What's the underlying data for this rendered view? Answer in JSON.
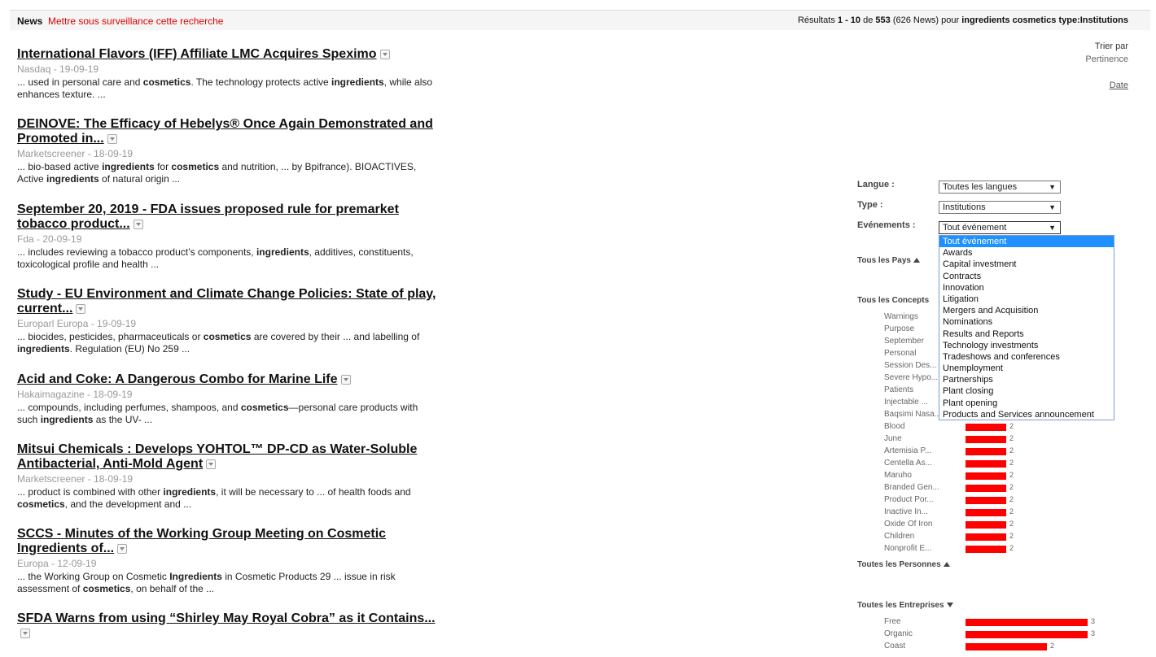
{
  "topbar": {
    "title": "News",
    "watch_link": "Mettre sous surveillance cette recherche",
    "results_prefix": "Résultats",
    "results_range": "1 - 10",
    "results_of": "de",
    "results_total": "553",
    "results_news": "(626 News) pour",
    "results_query": "ingredients cosmetics type:Institutions"
  },
  "articles": [
    {
      "title": "International Flavors (IFF) Affiliate LMC Acquires Speximo",
      "source": "Nasdaq - 19-09-19",
      "snippet": [
        [
          "... used in personal care and ",
          false
        ],
        [
          "cosmetics",
          true
        ],
        [
          ". The technology protects active ",
          false
        ],
        [
          "ingredients",
          true
        ],
        [
          ", while also enhances texture. ...",
          false
        ]
      ]
    },
    {
      "title": "DEINOVE: The Efficacy of Hebelys® Once Again Demonstrated and Promoted in...",
      "source": "Marketscreener - 18-09-19",
      "snippet": [
        [
          "... bio-based active ",
          false
        ],
        [
          "ingredients",
          true
        ],
        [
          " for ",
          false
        ],
        [
          "cosmetics",
          true
        ],
        [
          " and nutrition, ... by Bpifrance). BIOACTIVES, Active ",
          false
        ],
        [
          "ingredients",
          true
        ],
        [
          " of natural origin ...",
          false
        ]
      ]
    },
    {
      "title": "September 20, 2019 - FDA issues proposed rule for premarket tobacco product...",
      "source": "Fda - 20-09-19",
      "snippet": [
        [
          "... includes reviewing a tobacco product’s components, ",
          false
        ],
        [
          "ingredients",
          true
        ],
        [
          ", additives, constituents, toxicological profile and health ...",
          false
        ]
      ]
    },
    {
      "title": "Study - EU Environment and Climate Change Policies: State of play, current...",
      "source": "Europarl Europa - 19-09-19",
      "snippet": [
        [
          "... biocides, pesticides, pharmaceuticals or ",
          false
        ],
        [
          "cosmetics",
          true
        ],
        [
          " are covered by their ... and labelling of ",
          false
        ],
        [
          "ingredients",
          true
        ],
        [
          ". Regulation (EU) No 259 ...",
          false
        ]
      ]
    },
    {
      "title": "Acid and Coke: A Dangerous Combo for Marine Life",
      "source": "Hakaimagazine - 18-09-19",
      "snippet": [
        [
          "... compounds, including perfumes, shampoos, and ",
          false
        ],
        [
          "cosmetics",
          true
        ],
        [
          "—personal care products with such ",
          false
        ],
        [
          "ingredients",
          true
        ],
        [
          " as the UV- ...",
          false
        ]
      ]
    },
    {
      "title": "Mitsui Chemicals : Develops YOHTOL™ DP-CD as Water-Soluble Antibacterial, Anti-Mold Agent",
      "source": "Marketscreener - 18-09-19",
      "snippet": [
        [
          "... product is combined with other ",
          false
        ],
        [
          "ingredients",
          true
        ],
        [
          ", it will be necessary to ... of health foods and ",
          false
        ],
        [
          "cosmetics",
          true
        ],
        [
          ", and the development and ...",
          false
        ]
      ]
    },
    {
      "title": "SCCS - Minutes of the Working Group Meeting on Cosmetic Ingredients of...",
      "source": "Europa - 12-09-19",
      "snippet": [
        [
          "... the Working Group on Cosmetic ",
          false
        ],
        [
          "Ingredients",
          true
        ],
        [
          " in Cosmetic Products 29 ... issue in risk assessment of ",
          false
        ],
        [
          "cosmetics",
          true
        ],
        [
          ", on behalf of the ...",
          false
        ]
      ]
    },
    {
      "title": "SFDA Warns from using “Shirley May Royal Cobra” as it Contains...",
      "source": "",
      "snippet": []
    }
  ],
  "sort": {
    "label": "Trier par",
    "relevance": "Pertinence",
    "date": "Date"
  },
  "filters": {
    "language": {
      "label": "Langue :",
      "value": "Toutes les langues"
    },
    "type": {
      "label": "Type :",
      "value": "Institutions"
    },
    "events": {
      "label": "Evénements :",
      "value": "Tout événement",
      "options": [
        "Tout événement",
        "Awards",
        "Capital investment",
        "Contracts",
        "Innovation",
        "Litigation",
        "Mergers and Acquisition",
        "Nominations",
        "Results and Reports",
        "Technology investments",
        "Tradeshows and conferences",
        "Unemployment",
        "Partnerships",
        "Plant closing",
        "Plant opening",
        "Products and Services announcement"
      ]
    }
  },
  "sections": {
    "countries": "Tous les Pays",
    "concepts": "Tous les Concepts",
    "persons": "Toutes les Personnes",
    "companies": "Toutes les Entreprises"
  },
  "concepts": [
    {
      "name": "Warnings",
      "count": null,
      "bar": 0
    },
    {
      "name": "Purpose",
      "count": null,
      "bar": 0
    },
    {
      "name": "September",
      "count": null,
      "bar": 0
    },
    {
      "name": "Personal",
      "count": null,
      "bar": 0
    },
    {
      "name": "Session Des...",
      "count": null,
      "bar": 0
    },
    {
      "name": "Severe Hypo...",
      "count": null,
      "bar": 0
    },
    {
      "name": "Patients",
      "count": null,
      "bar": 0
    },
    {
      "name": "Injectable ...",
      "count": null,
      "bar": 0
    },
    {
      "name": "Baqsimi Nasa...",
      "count": null,
      "bar": 0
    },
    {
      "name": "Blood",
      "count": "2",
      "bar": 2
    },
    {
      "name": "June",
      "count": "2",
      "bar": 2
    },
    {
      "name": "Artemisia P...",
      "count": "2",
      "bar": 2
    },
    {
      "name": "Centella As...",
      "count": "2",
      "bar": 2
    },
    {
      "name": "Maruho",
      "count": "2",
      "bar": 2
    },
    {
      "name": "Branded Gen...",
      "count": "2",
      "bar": 2
    },
    {
      "name": "Product Por...",
      "count": "2",
      "bar": 2
    },
    {
      "name": "Inactive In...",
      "count": "2",
      "bar": 2
    },
    {
      "name": "Oxide Of Iron",
      "count": "2",
      "bar": 2
    },
    {
      "name": "Children",
      "count": "2",
      "bar": 2
    },
    {
      "name": "Nonprofit E...",
      "count": "2",
      "bar": 2
    }
  ],
  "companies": [
    {
      "name": "Free",
      "count": "3",
      "bar": 3
    },
    {
      "name": "Organic",
      "count": "3",
      "bar": 3
    },
    {
      "name": "Coast",
      "count": "2",
      "bar": 2
    }
  ],
  "colors": {
    "bar": "#ff0000",
    "link_red": "#dd0000",
    "selected_option": "#1e90ff"
  }
}
